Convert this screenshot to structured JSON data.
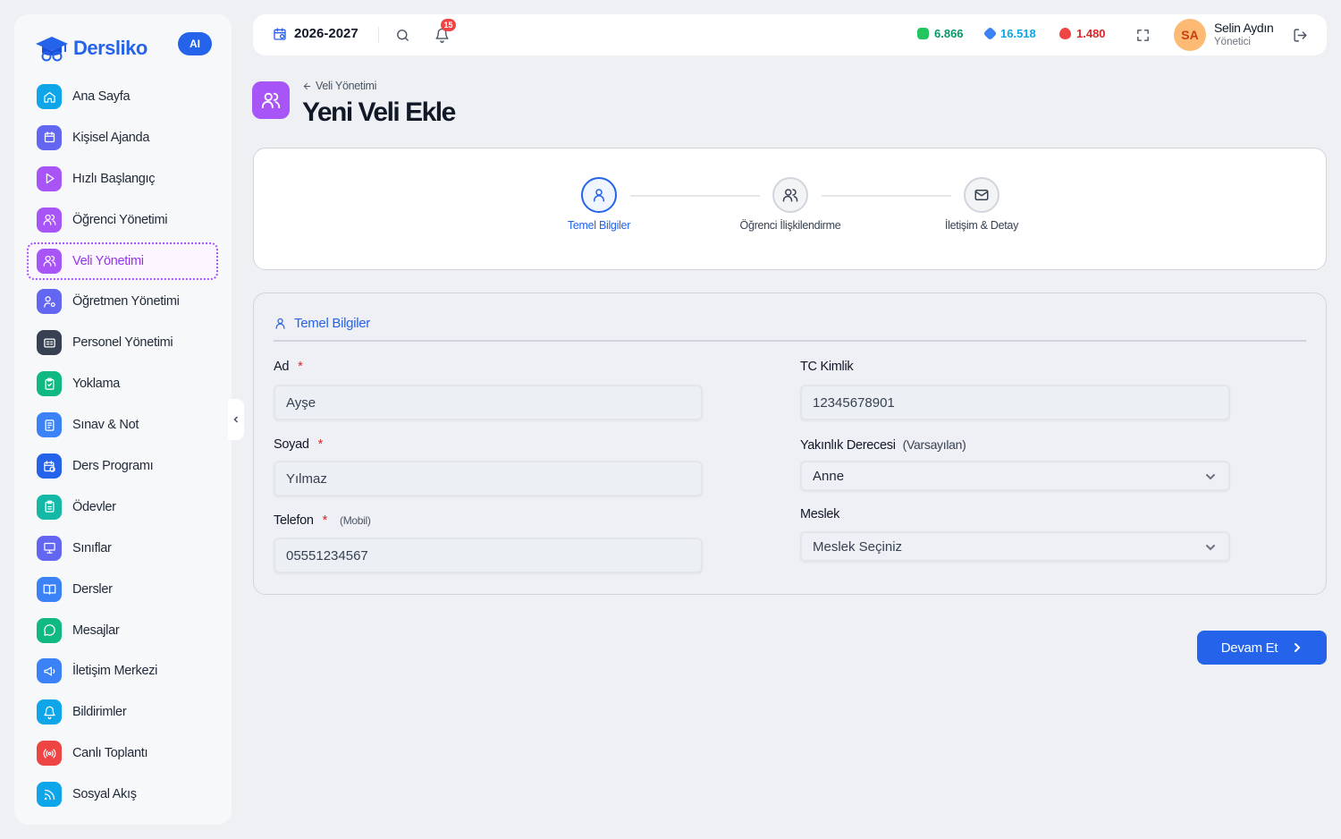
{
  "brand": {
    "name": "Dersliko",
    "ai_badge": "AI"
  },
  "sidebar": {
    "items": [
      {
        "label": "Ana Sayfa",
        "icon": "home-icon",
        "color": "#0ea5e9"
      },
      {
        "label": "Kişisel Ajanda",
        "icon": "calendar-icon",
        "color": "#6366f1"
      },
      {
        "label": "Hızlı Başlangıç",
        "icon": "play-icon",
        "color": "#a855f7"
      },
      {
        "label": "Öğrenci Yönetimi",
        "icon": "users-icon",
        "color": "#a855f7"
      },
      {
        "label": "Veli Yönetimi",
        "icon": "users-icon",
        "color": "#a855f7",
        "active": true
      },
      {
        "label": "Öğretmen Yönetimi",
        "icon": "teacher-icon",
        "color": "#6366f1"
      },
      {
        "label": "Personel Yönetimi",
        "icon": "id-card-icon",
        "color": "#374151"
      },
      {
        "label": "Yoklama",
        "icon": "clipboard-check-icon",
        "color": "#10b981"
      },
      {
        "label": "Sınav & Not",
        "icon": "exam-icon",
        "color": "#3b82f6"
      },
      {
        "label": "Ders Programı",
        "icon": "calendar-clock-icon",
        "color": "#2563eb"
      },
      {
        "label": "Ödevler",
        "icon": "clipboard-icon",
        "color": "#14b8a6"
      },
      {
        "label": "Sınıflar",
        "icon": "presentation-icon",
        "color": "#6366f1"
      },
      {
        "label": "Dersler",
        "icon": "book-icon",
        "color": "#3b82f6"
      },
      {
        "label": "Mesajlar",
        "icon": "message-icon",
        "color": "#10b981"
      },
      {
        "label": "İletişim Merkezi",
        "icon": "megaphone-icon",
        "color": "#3b82f6"
      },
      {
        "label": "Bildirimler",
        "icon": "bell-icon",
        "color": "#0ea5e9"
      },
      {
        "label": "Canlı Toplantı",
        "icon": "broadcast-icon",
        "color": "#ef4444"
      },
      {
        "label": "Sosyal Akış",
        "icon": "rss-icon",
        "color": "#0ea5e9"
      }
    ]
  },
  "topbar": {
    "year": "2026-2027",
    "notifications": "15",
    "stats": [
      {
        "value": "6.866",
        "color": "#059669",
        "icon": "money-icon"
      },
      {
        "value": "16.518",
        "color": "#0ea5e9",
        "icon": "gem-icon"
      },
      {
        "value": "1.480",
        "color": "#dc2626",
        "icon": "fire-icon"
      }
    ],
    "user": {
      "initials": "SA",
      "name": "Selin Aydın",
      "role": "Yönetici"
    }
  },
  "page": {
    "breadcrumb": "Veli Yönetimi",
    "title": "Yeni Veli Ekle"
  },
  "stepper": {
    "steps": [
      {
        "label": "Temel Bilgiler",
        "active": true
      },
      {
        "label": "Öğrenci İlişkilendirme",
        "active": false
      },
      {
        "label": "İletişim & Detay",
        "active": false
      }
    ]
  },
  "form": {
    "section_title": "Temel Bilgiler",
    "first_name": {
      "label": "Ad",
      "required": "*",
      "value": "Ayşe"
    },
    "last_name": {
      "label": "Soyad",
      "required": "*",
      "value": "Yılmaz"
    },
    "phone": {
      "label": "Telefon",
      "required": "*",
      "hint": "(Mobil)",
      "value": "05551234567"
    },
    "tc": {
      "label": "TC Kimlik",
      "value": "12345678901"
    },
    "relation": {
      "label": "Yakınlık Derecesi",
      "hint": "(Varsayılan)",
      "value": "Anne"
    },
    "job": {
      "label": "Meslek",
      "value": "Meslek Seçiniz"
    }
  },
  "actions": {
    "continue": "Devam Et"
  }
}
